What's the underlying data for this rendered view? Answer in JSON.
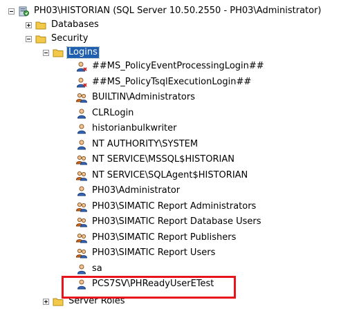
{
  "server": {
    "label": "PH03\\HISTORIAN (SQL Server 10.50.2550 - PH03\\Administrator)",
    "icon": "sql-server-icon"
  },
  "databases": {
    "label": "Databases",
    "expander": "+"
  },
  "security": {
    "label": "Security",
    "expander": "-"
  },
  "logins_folder": {
    "label": "Logins",
    "expander": "-"
  },
  "logins": [
    {
      "label": "##MS_PolicyEventProcessingLogin##",
      "icon": "disabled-login-icon"
    },
    {
      "label": "##MS_PolicyTsqlExecutionLogin##",
      "icon": "disabled-login-icon"
    },
    {
      "label": "BUILTIN\\Administrators",
      "icon": "group-login-icon"
    },
    {
      "label": "CLRLogin",
      "icon": "user-login-icon"
    },
    {
      "label": "historianbulkwriter",
      "icon": "user-login-icon"
    },
    {
      "label": "NT AUTHORITY\\SYSTEM",
      "icon": "user-login-icon"
    },
    {
      "label": "NT SERVICE\\MSSQL$HISTORIAN",
      "icon": "group-login-icon"
    },
    {
      "label": "NT SERVICE\\SQLAgent$HISTORIAN",
      "icon": "group-login-icon"
    },
    {
      "label": "PH03\\Administrator",
      "icon": "user-login-icon"
    },
    {
      "label": "PH03\\SIMATIC Report Administrators",
      "icon": "group-login-icon"
    },
    {
      "label": "PH03\\SIMATIC Report Database Users",
      "icon": "group-login-icon"
    },
    {
      "label": "PH03\\SIMATIC Report Publishers",
      "icon": "group-login-icon"
    },
    {
      "label": "PH03\\SIMATIC Report Users",
      "icon": "group-login-icon"
    },
    {
      "label": "sa",
      "icon": "user-login-icon"
    },
    {
      "label": "PCS7SV\\PHReadyUserETest",
      "icon": "user-login-icon"
    }
  ],
  "server_roles": {
    "label": "Server Roles",
    "expander": "+"
  },
  "colors": {
    "selection": "#1f5fb0",
    "highlight_box": "#e8141b",
    "folder": "#f3c94a"
  }
}
